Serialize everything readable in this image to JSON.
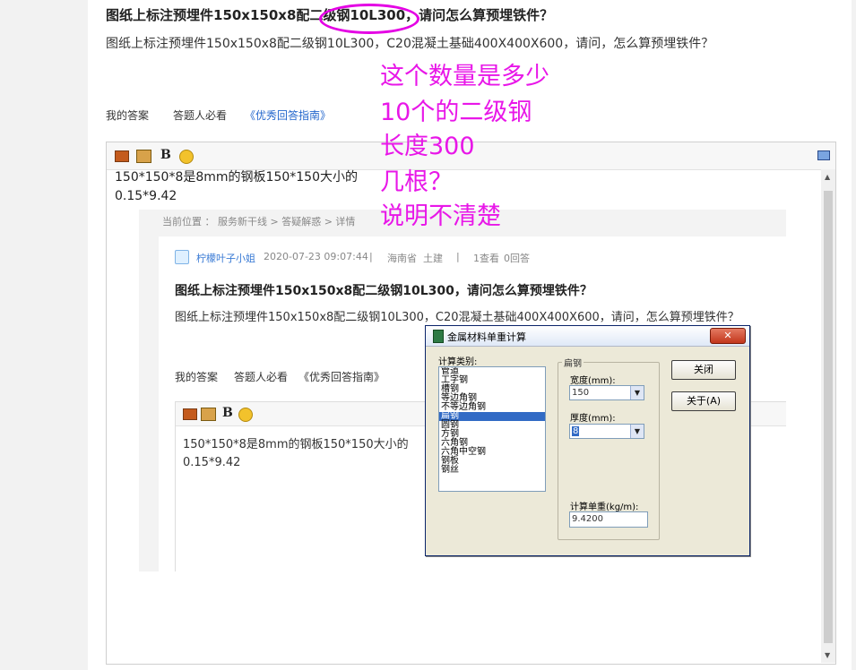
{
  "question": {
    "title": "图纸上标注预埋件150x150x8配二级钢10L300，请问怎么算预埋铁件？",
    "description": "图纸上标注预埋件150x150x8配二级钢10L300，C20混凝土基础400X400X600，请问，怎么算预埋铁件？"
  },
  "annotations": {
    "lines": [
      "这个数量是多少",
      "10个的二级钢",
      "长度300",
      "几根？",
      "说明不清楚"
    ],
    "color": "#e817e8"
  },
  "answer_bar": {
    "my_answer": "我的答案",
    "must_read": "答题人必看",
    "guide": "《优秀回答指南》"
  },
  "editor": {
    "text_line1": "150*150*8是8mm的钢板150*150大小的",
    "text_line2": "0.15*9.42",
    "bold_label": "B"
  },
  "embedded_screenshot": {
    "breadcrumb": "当前位置 ： 服务新干线 > 答疑解惑 > 详情",
    "user": "柠檬叶子小姐",
    "datetime": "2020-07-23 09:07:44",
    "location": "海南省",
    "category": "土建",
    "views": "1查看",
    "answers": "0回答",
    "separator": "|",
    "title": "图纸上标注预埋件150x150x8配二级钢10L300，请问怎么算预埋铁件？",
    "description": "图纸上标注预埋件150x150x8配二级钢10L300，C20混凝土基础400X400X600，请问，怎么算预埋铁件？",
    "my_answer": "我的答案",
    "must_read": "答题人必看",
    "guide": "《优秀回答指南》",
    "editor_line1": "150*150*8是8mm的钢板150*150大小的",
    "editor_line2": "0.15*9.42"
  },
  "dialog": {
    "title": "金属材料单重计算",
    "close_glyph": "✕",
    "category_label": "计算类别:",
    "categories": [
      "管道",
      "工字钢",
      "槽钢",
      "等边角钢",
      "不等边角钢",
      "扁钢",
      "圆钢",
      "方钢",
      "六角钢",
      "六角中空钢",
      "钢板",
      "钢丝"
    ],
    "selected_category": "扁钢",
    "group_label": "扁钢",
    "width_label": "宽度(mm):",
    "width_value": "150",
    "thickness_label": "厚度(mm):",
    "thickness_value": "8",
    "unit_weight_label": "计算单重(kg/m):",
    "unit_weight_value": "9.4200",
    "close_button": "关闭",
    "about_button": "关于(A)"
  }
}
